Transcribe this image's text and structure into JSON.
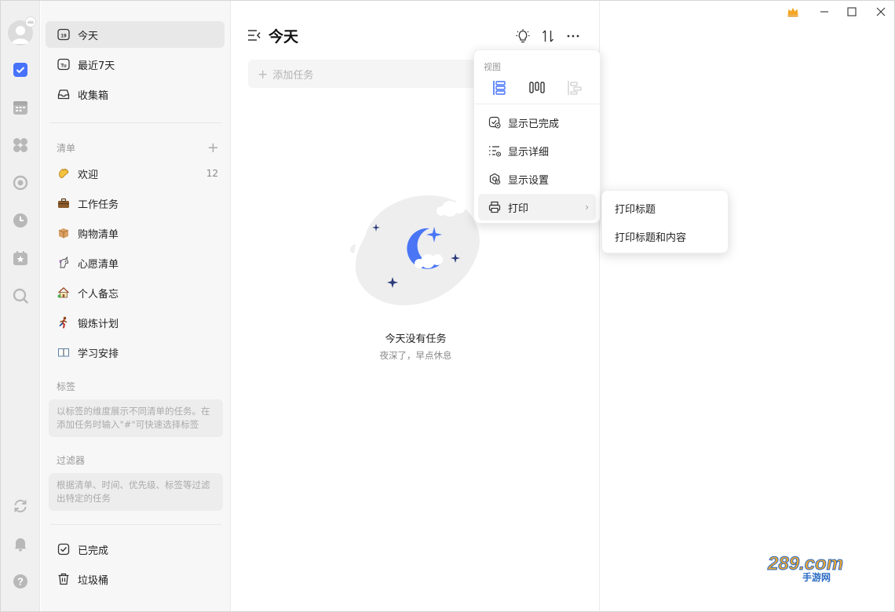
{
  "colors": {
    "accent": "#4772fa",
    "rail_bg": "#f0f0f0",
    "sidebar_bg": "#f7f7f7",
    "moon": "#4a76f6",
    "crown": "#f5a623"
  },
  "rail": {
    "icons": [
      "avatar-icon",
      "check-icon",
      "calendar-icon",
      "grid-icon",
      "focus-icon",
      "clock-icon",
      "habit-icon",
      "search-icon",
      "sync-icon",
      "bell-icon",
      "help-icon"
    ]
  },
  "sidebar": {
    "top_items": [
      {
        "label": "今天",
        "icon": "calendar-19-icon",
        "badge": "19"
      },
      {
        "label": "最近7天",
        "icon": "calendar-tu-icon",
        "badge": "Tu"
      },
      {
        "label": "收集箱",
        "icon": "inbox-icon"
      }
    ],
    "lists_title": "清单",
    "lists": [
      {
        "label": "欢迎",
        "emoji": "👋",
        "count": "12"
      },
      {
        "label": "工作任务",
        "emoji": "💼"
      },
      {
        "label": "购物清单",
        "emoji": "📦"
      },
      {
        "label": "心愿清单",
        "emoji": "🦄"
      },
      {
        "label": "个人备忘",
        "emoji": "🏡"
      },
      {
        "label": "锻炼计划",
        "emoji": "🏃"
      },
      {
        "label": "学习安排",
        "emoji": "📖"
      }
    ],
    "tags_title": "标签",
    "tags_hint": "以标签的维度展示不同清单的任务。在添加任务时输入\"#\"可快速选择标签",
    "filters_title": "过滤器",
    "filters_hint": "根据清单、时间、优先级、标签等过滤出特定的任务",
    "bottom_items": [
      {
        "label": "已完成",
        "icon": "checkbox-icon"
      },
      {
        "label": "垃圾桶",
        "icon": "trash-icon"
      }
    ]
  },
  "main": {
    "title": "今天",
    "add_task_placeholder": "添加任务",
    "empty_title": "今天没有任务",
    "empty_subtitle": "夜深了，早点休息"
  },
  "dropdown": {
    "view_label": "视图",
    "items": [
      {
        "label": "显示已完成",
        "icon": "show-completed-icon"
      },
      {
        "label": "显示详细",
        "icon": "show-details-icon"
      },
      {
        "label": "显示设置",
        "icon": "display-settings-icon"
      },
      {
        "label": "打印",
        "icon": "print-icon"
      }
    ]
  },
  "submenu": {
    "items": [
      "打印标题",
      "打印标题和内容"
    ]
  },
  "watermark": {
    "text": "289.com",
    "sub": "手游网"
  }
}
